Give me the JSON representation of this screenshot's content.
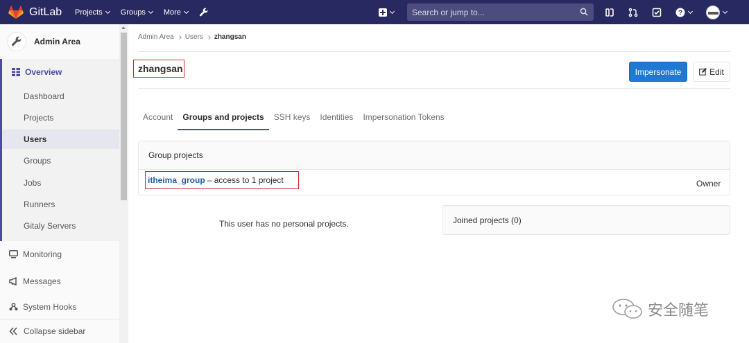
{
  "navbar": {
    "brand": "GitLab",
    "menu": [
      "Projects",
      "Groups",
      "More"
    ],
    "search_placeholder": "Search or jump to...",
    "colors": {
      "background": "#292961",
      "search": "#4c4c7e"
    }
  },
  "sidebar": {
    "title": "Admin Area",
    "overview": "Overview",
    "overview_items": [
      "Dashboard",
      "Projects",
      "Users",
      "Groups",
      "Jobs",
      "Runners",
      "Gitaly Servers"
    ],
    "active_item": "Users",
    "items": [
      "Monitoring",
      "Messages",
      "System Hooks"
    ],
    "collapse": "Collapse sidebar"
  },
  "breadcrumb": [
    "Admin Area",
    "Users",
    "zhangsan"
  ],
  "user": {
    "name": "zhangsan",
    "impersonate": "Impersonate",
    "edit": "Edit"
  },
  "tabs": [
    {
      "label": "Account",
      "active": false
    },
    {
      "label": "Groups and projects",
      "active": true
    },
    {
      "label": "SSH keys",
      "active": false
    },
    {
      "label": "Identities",
      "active": false
    },
    {
      "label": "Impersonation Tokens",
      "active": false
    }
  ],
  "group_projects": {
    "title": "Group projects",
    "group_name": "itheima_group",
    "group_desc": "– access to 1 project",
    "role": "Owner"
  },
  "personal_projects": {
    "empty_text": "This user has no personal projects."
  },
  "joined_projects": {
    "title": "Joined projects (0)"
  },
  "watermark": "安全随笔",
  "accent": {
    "primary": "#1f78d1",
    "nav_active": "#4b4ba3",
    "highlight_box": "#d9242b"
  }
}
